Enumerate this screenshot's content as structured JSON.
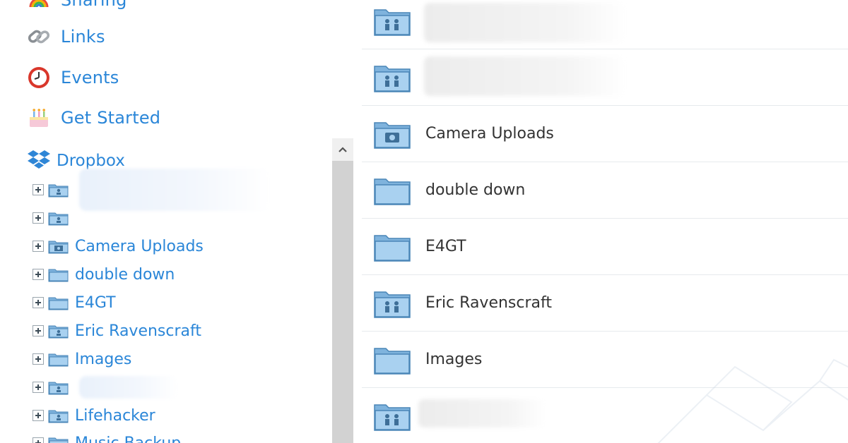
{
  "sidebar": {
    "nav": [
      {
        "label": "Sharing",
        "icon": "rainbow-icon"
      },
      {
        "label": "Links",
        "icon": "chain-link-icon"
      },
      {
        "label": "Events",
        "icon": "clock-icon"
      },
      {
        "label": "Get Started",
        "icon": "cake-icon"
      }
    ],
    "tree_root": {
      "label": "Dropbox",
      "icon": "dropbox-icon"
    },
    "tree": [
      {
        "label": "",
        "folder": "shared-folder-icon"
      },
      {
        "label": "",
        "folder": "shared-folder-icon"
      },
      {
        "label": "Camera Uploads",
        "folder": "camera-folder-icon"
      },
      {
        "label": "double down",
        "folder": "folder-icon"
      },
      {
        "label": "E4GT",
        "folder": "folder-icon"
      },
      {
        "label": "Eric Ravenscraft",
        "folder": "shared-folder-icon"
      },
      {
        "label": "Images",
        "folder": "folder-icon"
      },
      {
        "label": "",
        "folder": "shared-folder-icon"
      },
      {
        "label": "Lifehacker",
        "folder": "shared-folder-icon"
      },
      {
        "label": "Music Backup",
        "folder": "shared-folder-icon"
      }
    ]
  },
  "files": [
    {
      "label": "",
      "folder": "shared-folder-icon"
    },
    {
      "label": "",
      "folder": "shared-folder-icon"
    },
    {
      "label": "Camera Uploads",
      "folder": "camera-folder-icon"
    },
    {
      "label": "double down",
      "folder": "folder-icon"
    },
    {
      "label": "E4GT",
      "folder": "folder-icon"
    },
    {
      "label": "Eric Ravenscraft",
      "folder": "shared-folder-icon"
    },
    {
      "label": "Images",
      "folder": "folder-icon"
    },
    {
      "label": "",
      "folder": "shared-folder-icon"
    }
  ],
  "colors": {
    "link_blue": "#2a86d8",
    "folder_blue": "#8fc3ea",
    "folder_dark": "#4a86b7"
  }
}
